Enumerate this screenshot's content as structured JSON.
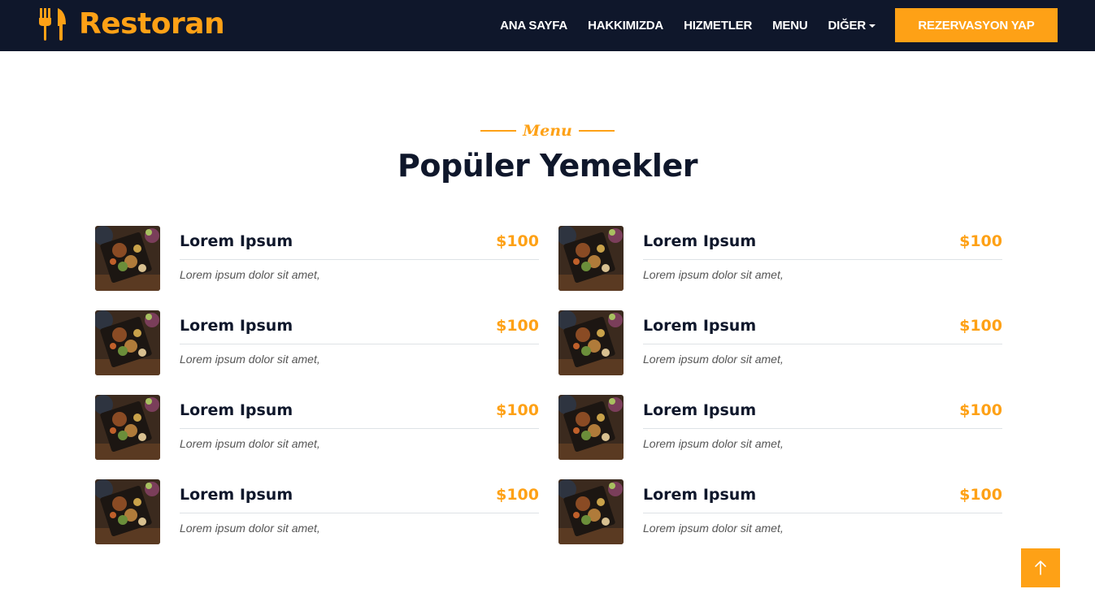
{
  "brand": {
    "name": "Restoran",
    "icon": "utensils-icon"
  },
  "nav": {
    "links": [
      "ANA SAYFA",
      "HAKKIMIZDA",
      "HIZMETLER",
      "MENU",
      "DIĞER"
    ],
    "cta": "REZERVASYON YAP"
  },
  "section": {
    "tag": "Menu",
    "title": "Popüler Yemekler"
  },
  "menu_items": [
    {
      "name": "Lorem Ipsum",
      "price": "$100",
      "desc": "Lorem ipsum dolor sit amet,"
    },
    {
      "name": "Lorem Ipsum",
      "price": "$100",
      "desc": "Lorem ipsum dolor sit amet,"
    },
    {
      "name": "Lorem Ipsum",
      "price": "$100",
      "desc": "Lorem ipsum dolor sit amet,"
    },
    {
      "name": "Lorem Ipsum",
      "price": "$100",
      "desc": "Lorem ipsum dolor sit amet,"
    },
    {
      "name": "Lorem Ipsum",
      "price": "$100",
      "desc": "Lorem ipsum dolor sit amet,"
    },
    {
      "name": "Lorem Ipsum",
      "price": "$100",
      "desc": "Lorem ipsum dolor sit amet,"
    },
    {
      "name": "Lorem Ipsum",
      "price": "$100",
      "desc": "Lorem ipsum dolor sit amet,"
    },
    {
      "name": "Lorem Ipsum",
      "price": "$100",
      "desc": "Lorem ipsum dolor sit amet,"
    }
  ],
  "colors": {
    "primary": "#fea116",
    "dark": "#0f172b"
  },
  "back_to_top": {
    "icon": "arrow-up-icon"
  }
}
